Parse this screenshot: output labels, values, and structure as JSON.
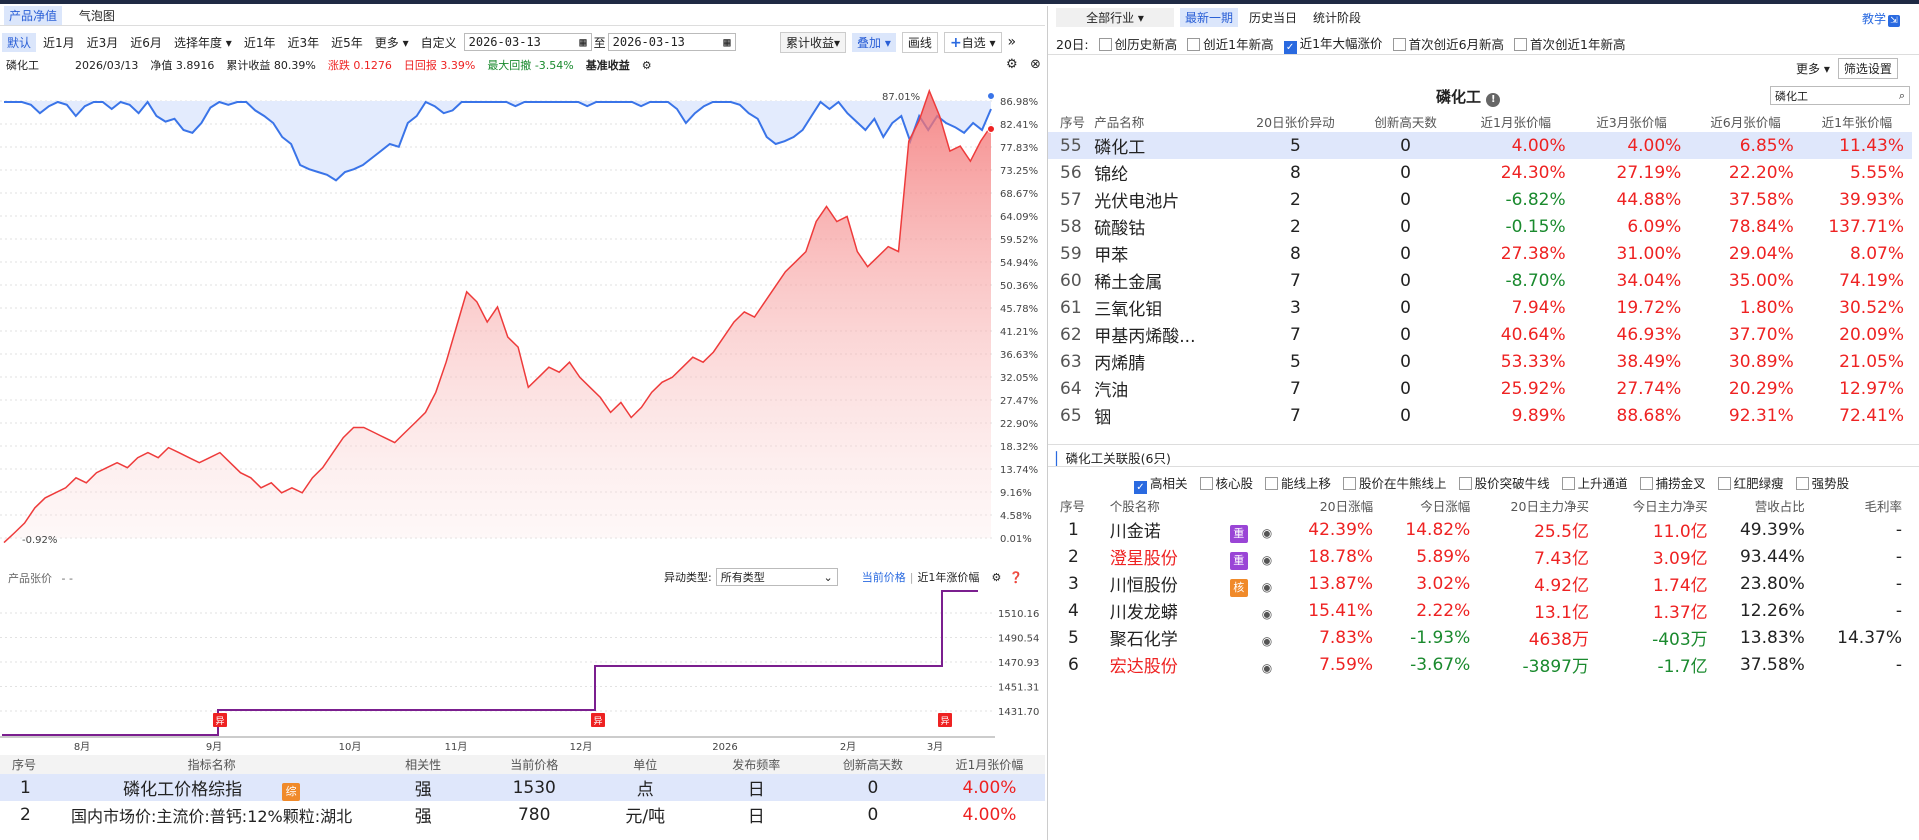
{
  "top_tabs": [
    "产品净值",
    "气泡图"
  ],
  "period_buttons": [
    "默认",
    "近1月",
    "近3月",
    "近6月",
    "选择年度",
    "近1年",
    "近3年",
    "近5年",
    "更多",
    "自定义"
  ],
  "date_from": "2026-03-13",
  "date_to_sep": "至",
  "date_to": "2026-03-13",
  "right_tools": [
    "累计收益",
    "叠加",
    "画线",
    "自选"
  ],
  "info": {
    "name": "磷化工",
    "date": "2026/03/13",
    "nav_label": "净值",
    "nav": "3.8916",
    "cum_label": "累计收益",
    "cum": "80.39%",
    "chg_label": "涨跌",
    "chg": "0.1276",
    "dd_label": "日回报",
    "dd": "3.39%",
    "maxdd_label": "最大回撤",
    "maxdd": "-3.54%",
    "bench": "基准收益"
  },
  "main_chart": {
    "y_ticks": [
      "86.98%",
      "82.41%",
      "77.83%",
      "73.25%",
      "68.67%",
      "64.09%",
      "59.52%",
      "54.94%",
      "50.36%",
      "45.78%",
      "41.21%",
      "36.63%",
      "32.05%",
      "27.47%",
      "22.90%",
      "18.32%",
      "13.74%",
      "9.16%",
      "4.58%",
      "0.01%"
    ],
    "start_label": "-0.92%",
    "peak_label": "87.01%"
  },
  "chart_data": {
    "type": "area",
    "ylabel": "",
    "ylim": [
      0.01,
      86.98
    ],
    "series": [
      {
        "name": "",
        "values": [
          -0.9,
          1,
          3,
          6,
          8,
          9,
          10,
          12,
          11,
          13,
          14,
          15,
          14,
          16,
          17,
          16,
          18,
          17,
          16,
          15,
          16,
          17,
          15,
          13,
          12,
          10,
          11,
          9,
          10,
          9,
          12,
          14,
          17,
          20,
          22,
          22,
          21,
          20,
          19,
          21,
          23,
          25,
          29,
          35,
          42,
          49,
          47,
          43,
          46,
          40,
          38,
          30,
          32,
          34,
          33,
          35,
          32,
          30,
          28,
          25,
          27,
          24,
          26,
          29,
          31,
          32,
          34,
          36,
          35,
          37,
          40,
          43,
          45,
          44,
          47,
          50,
          53,
          55,
          57,
          63,
          66,
          63,
          64,
          57,
          54,
          56,
          58,
          57,
          79,
          83,
          89,
          84,
          77,
          78,
          75,
          79,
          82
        ]
      }
    ]
  },
  "sub_chart": {
    "title": "产品张价",
    "title_extra": "-  -",
    "type_label": "异动类型:",
    "type_value": "所有类型",
    "tabs": [
      "当前价格",
      "近1年涨价幅"
    ],
    "y_ticks": [
      "1510.16",
      "1490.54",
      "1470.93",
      "1451.31",
      "1431.70"
    ],
    "x_ticks": [
      "8月",
      "9月",
      "10月",
      "11月",
      "12月",
      "2026",
      "2月",
      "3月"
    ],
    "marker": "异"
  },
  "bottom_table": {
    "headers": [
      "序号",
      "指标名称",
      "相关性",
      "当前价格",
      "单位",
      "发布频率",
      "创新高天数",
      "近1月张价幅"
    ],
    "rows": [
      [
        "1",
        "磷化工价格综指",
        "强",
        "1530",
        "点",
        "日",
        "0",
        "4.00%"
      ],
      [
        "2",
        "国内市场价:主流价:普钙:12%颗粒:湖北",
        "强",
        "780",
        "元/吨",
        "日",
        "0",
        "4.00%"
      ]
    ],
    "tag": "综"
  },
  "right": {
    "industry": "全部行业",
    "tabs": [
      "最新一期",
      "历史当日",
      "统计阶段"
    ],
    "teach": "教学",
    "filter_label": "20日:",
    "filters": [
      "创历史新高",
      "创近1年新高",
      "近1年大幅涨价",
      "首次创近6月新高",
      "首次创近1年新高"
    ],
    "more": "更多",
    "filter_set": "筛选设置",
    "title": "磷化工",
    "search": "磷化工",
    "headers": [
      "序号",
      "产品名称",
      "20日张价异动",
      "创新高天数",
      "近1月张价幅",
      "近3月张价幅",
      "近6月张价幅",
      "近1年张价幅"
    ],
    "rows": [
      [
        "55",
        "磷化工",
        "5",
        "0",
        "4.00%",
        "4.00%",
        "6.85%",
        "11.43%"
      ],
      [
        "56",
        "锦纶",
        "8",
        "0",
        "24.30%",
        "27.19%",
        "22.20%",
        "5.55%"
      ],
      [
        "57",
        "光伏电池片",
        "2",
        "0",
        "-6.82%",
        "44.88%",
        "37.58%",
        "39.93%"
      ],
      [
        "58",
        "硫酸钴",
        "2",
        "0",
        "-0.15%",
        "6.09%",
        "78.84%",
        "137.71%"
      ],
      [
        "59",
        "甲苯",
        "8",
        "0",
        "27.38%",
        "31.00%",
        "29.04%",
        "8.07%"
      ],
      [
        "60",
        "稀土金属",
        "7",
        "0",
        "-8.70%",
        "34.04%",
        "35.00%",
        "74.19%"
      ],
      [
        "61",
        "三氧化钼",
        "3",
        "0",
        "7.94%",
        "19.72%",
        "1.80%",
        "30.52%"
      ],
      [
        "62",
        "甲基丙烯酸...",
        "7",
        "0",
        "40.64%",
        "46.93%",
        "37.70%",
        "20.09%"
      ],
      [
        "63",
        "丙烯腈",
        "5",
        "0",
        "53.33%",
        "38.49%",
        "30.89%",
        "21.05%"
      ],
      [
        "64",
        "汽油",
        "7",
        "0",
        "25.92%",
        "27.74%",
        "20.29%",
        "12.97%"
      ],
      [
        "65",
        "铟",
        "7",
        "0",
        "9.89%",
        "88.68%",
        "92.31%",
        "72.41%"
      ]
    ],
    "stock_title": "磷化工关联股(6只)",
    "stock_filters": [
      "高相关",
      "核心股",
      "能线上移",
      "股价在牛熊线上",
      "股价突破牛线",
      "上升通道",
      "捕捞金叉",
      "红肥绿瘦",
      "强势股"
    ],
    "stock_headers": [
      "序号",
      "个股名称",
      "20日涨幅",
      "今日涨幅",
      "20日主力净买",
      "今日主力净买",
      "营收占比",
      "毛利率"
    ],
    "stocks": [
      [
        "1",
        "川金诺",
        "重",
        "42.39%",
        "14.82%",
        "25.5亿",
        "11.0亿",
        "49.39%",
        "-"
      ],
      [
        "2",
        "澄星股份",
        "重",
        "18.78%",
        "5.89%",
        "7.43亿",
        "3.09亿",
        "93.44%",
        "-"
      ],
      [
        "3",
        "川恒股份",
        "核",
        "13.87%",
        "3.02%",
        "4.92亿",
        "1.74亿",
        "23.80%",
        "-"
      ],
      [
        "4",
        "川发龙蟒",
        "",
        "15.41%",
        "2.22%",
        "13.1亿",
        "1.37亿",
        "12.26%",
        "-"
      ],
      [
        "5",
        "聚石化学",
        "",
        "7.83%",
        "-1.93%",
        "4638万",
        "-403万",
        "13.83%",
        "14.37%"
      ],
      [
        "6",
        "宏达股份",
        "",
        "7.59%",
        "-3.67%",
        "-3897万",
        "-1.7亿",
        "37.58%",
        "-"
      ]
    ]
  }
}
